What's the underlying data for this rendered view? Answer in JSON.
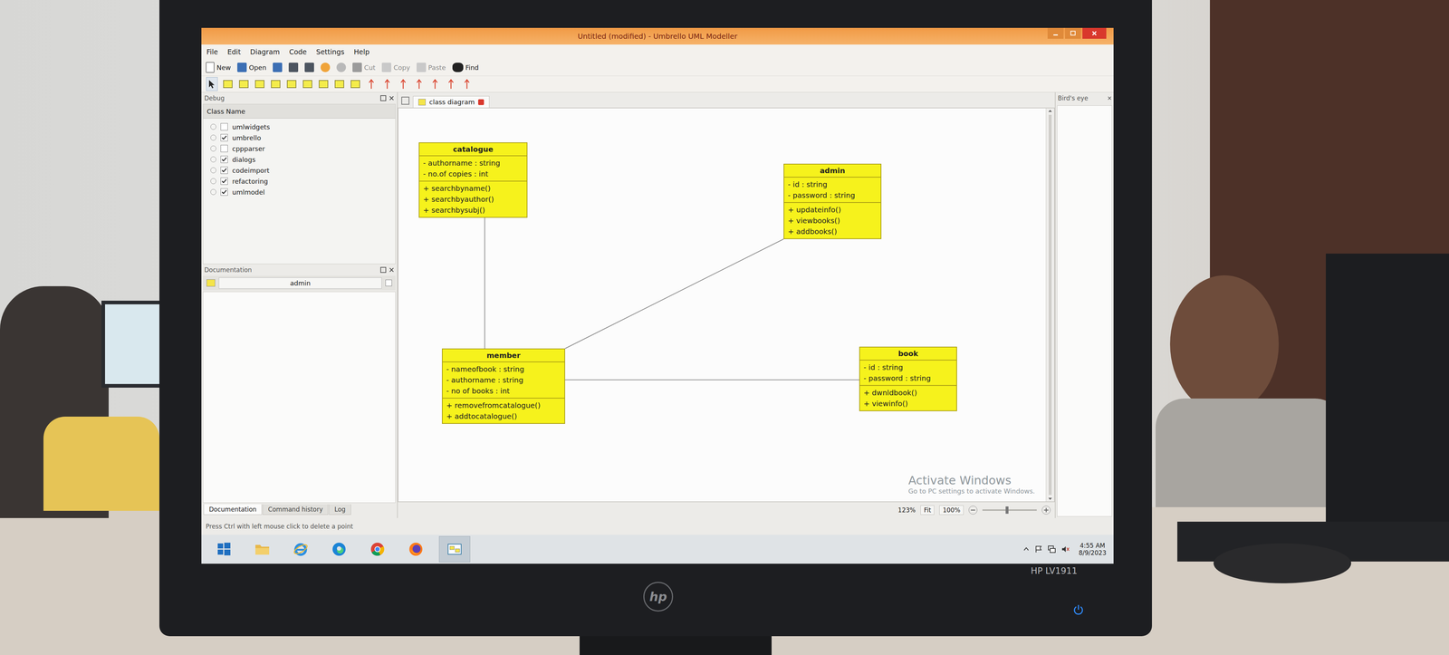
{
  "window": {
    "title": "Untitled (modified) - Umbrello UML Modeller"
  },
  "menu": [
    "File",
    "Edit",
    "Diagram",
    "Code",
    "Settings",
    "Help"
  ],
  "toolbar": [
    {
      "kind": "new",
      "label": "New",
      "disabled": false
    },
    {
      "kind": "open",
      "label": "Open",
      "disabled": false
    },
    {
      "kind": "save",
      "disabled": false
    },
    {
      "kind": "print",
      "disabled": false
    },
    {
      "kind": "export",
      "disabled": false
    },
    {
      "kind": "undo",
      "disabled": false
    },
    {
      "kind": "redo",
      "disabled": true
    },
    {
      "kind": "cut",
      "label": "Cut",
      "disabled": true
    },
    {
      "kind": "copy",
      "label": "Copy",
      "disabled": true
    },
    {
      "kind": "paste",
      "label": "Paste",
      "disabled": true
    },
    {
      "kind": "find",
      "label": "Find",
      "disabled": false
    }
  ],
  "palette": [
    {
      "kind": "pointer",
      "selected": true
    },
    {
      "kind": "box",
      "selected": false
    },
    {
      "kind": "box",
      "selected": false
    },
    {
      "kind": "box",
      "selected": false
    },
    {
      "kind": "box",
      "selected": false
    },
    {
      "kind": "box",
      "selected": false
    },
    {
      "kind": "box",
      "selected": false
    },
    {
      "kind": "box",
      "selected": false
    },
    {
      "kind": "box",
      "selected": false
    },
    {
      "kind": "box",
      "selected": false
    },
    {
      "kind": "arrow",
      "selected": false
    },
    {
      "kind": "arrow",
      "selected": false
    },
    {
      "kind": "arrow",
      "selected": false
    },
    {
      "kind": "arrow",
      "selected": false
    },
    {
      "kind": "arrow",
      "selected": false
    },
    {
      "kind": "arrow",
      "selected": false
    },
    {
      "kind": "arrow",
      "selected": false
    }
  ],
  "debug_dock": {
    "title": "Debug",
    "column": "Class Name",
    "items": [
      {
        "label": "umlwidgets",
        "checked": false
      },
      {
        "label": "umbrello",
        "checked": true
      },
      {
        "label": "cppparser",
        "checked": false
      },
      {
        "label": "dialogs",
        "checked": true
      },
      {
        "label": "codeimport",
        "checked": true
      },
      {
        "label": "refactoring",
        "checked": true
      },
      {
        "label": "umlmodel",
        "checked": true
      }
    ]
  },
  "documentation_dock": {
    "title": "Documentation",
    "field": "admin"
  },
  "bottom_tabs": [
    {
      "label": "Documentation",
      "selected": true
    },
    {
      "label": "Command history",
      "selected": false
    },
    {
      "label": "Log",
      "selected": false
    }
  ],
  "diagram_tabs": [
    {
      "label": "class diagram",
      "selected": true
    }
  ],
  "diagram": {
    "classes": [
      {
        "name": "catalogue",
        "attributes": [
          "- authorname : string",
          "- no.of copies : int"
        ],
        "operations": [
          "+ searchbyname()",
          "+ searchbyauthor()",
          "+ searchbysubj()"
        ]
      },
      {
        "name": "admin",
        "attributes": [
          "- id : string",
          "- password : string"
        ],
        "operations": [
          "+ updateinfo()",
          "+ viewbooks()",
          "+ addbooks()"
        ]
      },
      {
        "name": "member",
        "attributes": [
          "- nameofbook : string",
          "- authorname : string",
          "- no of books : int"
        ],
        "operations": [
          "+ removefromcatalogue()",
          "+ addtocatalogue()"
        ]
      },
      {
        "name": "book",
        "attributes": [
          "- id : string",
          "- password : string"
        ],
        "operations": [
          "+ dwnldbook()",
          "+ viewinfo()"
        ]
      }
    ],
    "associations": [
      {
        "from": "catalogue",
        "to": "member"
      },
      {
        "from": "admin",
        "to": "member"
      },
      {
        "from": "member",
        "to": "book"
      }
    ]
  },
  "birds_eye": {
    "title": "Bird's eye"
  },
  "zoom": {
    "reading": "123%",
    "fit": "Fit",
    "reset": "100%",
    "level": 0.45
  },
  "watermark": {
    "title": "Activate Windows",
    "subtitle": "Go to PC settings to activate Windows."
  },
  "status_bar": "Press Ctrl with left mouse click to delete a point",
  "taskbar": {
    "apps": [
      {
        "kind": "start",
        "active": false
      },
      {
        "kind": "explorer",
        "active": false
      },
      {
        "kind": "ie",
        "active": false
      },
      {
        "kind": "edge",
        "active": false
      },
      {
        "kind": "chrome",
        "active": false
      },
      {
        "kind": "firefox",
        "active": false
      },
      {
        "kind": "umbrello",
        "active": true
      }
    ],
    "tray": [
      {
        "kind": "chevron"
      },
      {
        "kind": "flag"
      },
      {
        "kind": "network"
      },
      {
        "kind": "volume"
      }
    ],
    "time": "4:55 AM",
    "date": "8/9/2023"
  },
  "monitor": {
    "logo": "hp",
    "model": "HP LV1911",
    "power_on": true
  }
}
